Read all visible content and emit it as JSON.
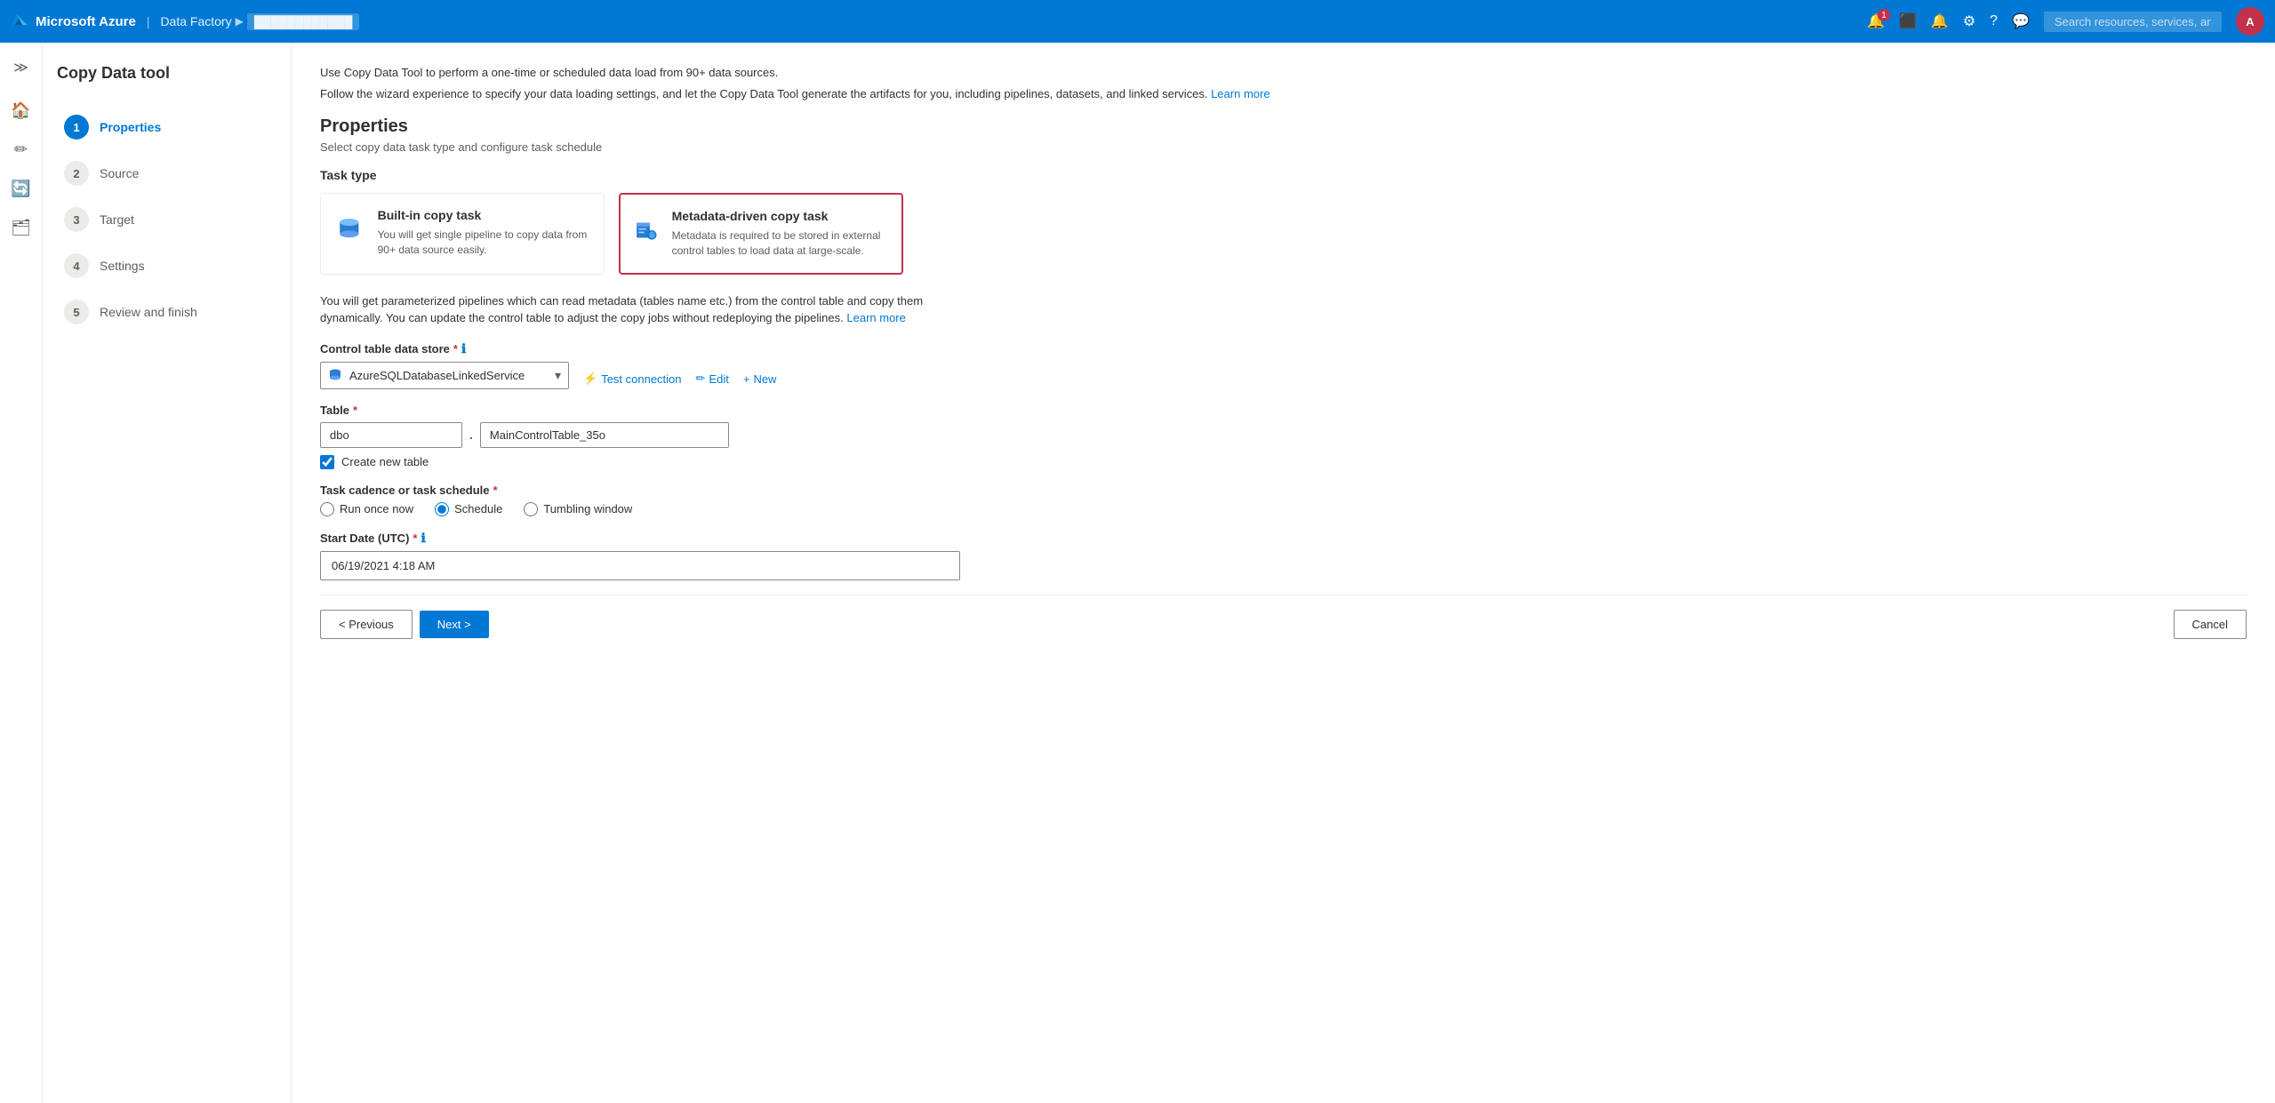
{
  "topbar": {
    "brand": "Microsoft Azure",
    "separator": "|",
    "app_name": "Data Factory",
    "arrow": "▶",
    "breadcrumb": "████████████",
    "notification_count": "1",
    "search_placeholder": "Search resources, services, and docs (G+/)"
  },
  "steps_sidebar": {
    "title": "Copy Data tool",
    "steps": [
      {
        "number": "1",
        "label": "Properties",
        "active": true
      },
      {
        "number": "2",
        "label": "Source",
        "active": false
      },
      {
        "number": "3",
        "label": "Target",
        "active": false
      },
      {
        "number": "4",
        "label": "Settings",
        "active": false
      },
      {
        "number": "5",
        "label": "Review and finish",
        "active": false
      }
    ]
  },
  "main": {
    "intro_line1": "Use Copy Data Tool to perform a one-time or scheduled data load from 90+ data sources.",
    "intro_line2": "Follow the wizard experience to specify your data loading settings, and let the Copy Data Tool generate the artifacts for you, including pipelines, datasets, and linked services.",
    "learn_more": "Learn more",
    "section_title": "Properties",
    "section_subtitle": "Select copy data task type and configure task schedule",
    "task_type_label": "Task type",
    "task_cards": [
      {
        "id": "built-in",
        "title": "Built-in copy task",
        "description": "You will get single pipeline to copy data from 90+ data source easily.",
        "selected": false
      },
      {
        "id": "metadata-driven",
        "title": "Metadata-driven copy task",
        "description": "Metadata is required to be stored in external control tables to load data at large-scale.",
        "selected": true
      }
    ],
    "info_text": "You will get parameterized pipelines which can read metadata (tables name etc.) from the control table and copy them dynamically. You can update the control table to adjust the copy jobs without redeploying the pipelines.",
    "info_learn_more": "Learn more",
    "control_table_label": "Control table data store",
    "control_table_required": true,
    "control_table_value": "AzureSQLDatabaseLinkedService",
    "control_table_options": [
      "AzureSQLDatabaseLinkedService"
    ],
    "action_test_connection": "Test connection",
    "action_edit": "Edit",
    "action_new": "New",
    "table_label": "Table",
    "table_required": true,
    "table_schema": "dbo",
    "table_name": "MainControlTable_35o",
    "create_new_table_label": "Create new table",
    "create_new_table_checked": true,
    "cadence_label": "Task cadence or task schedule",
    "cadence_required": true,
    "cadence_options": [
      {
        "value": "run-once",
        "label": "Run once now"
      },
      {
        "value": "schedule",
        "label": "Schedule",
        "selected": true
      },
      {
        "value": "tumbling",
        "label": "Tumbling window"
      }
    ],
    "start_date_label": "Start Date (UTC)",
    "start_date_required": true,
    "start_date_value": "06/19/2021 4:18 AM",
    "btn_previous": "< Previous",
    "btn_next": "Next >",
    "btn_cancel": "Cancel"
  },
  "colors": {
    "primary": "#0078d4",
    "selected_border": "#c4314b",
    "text_primary": "#323130",
    "text_secondary": "#605e5c"
  }
}
